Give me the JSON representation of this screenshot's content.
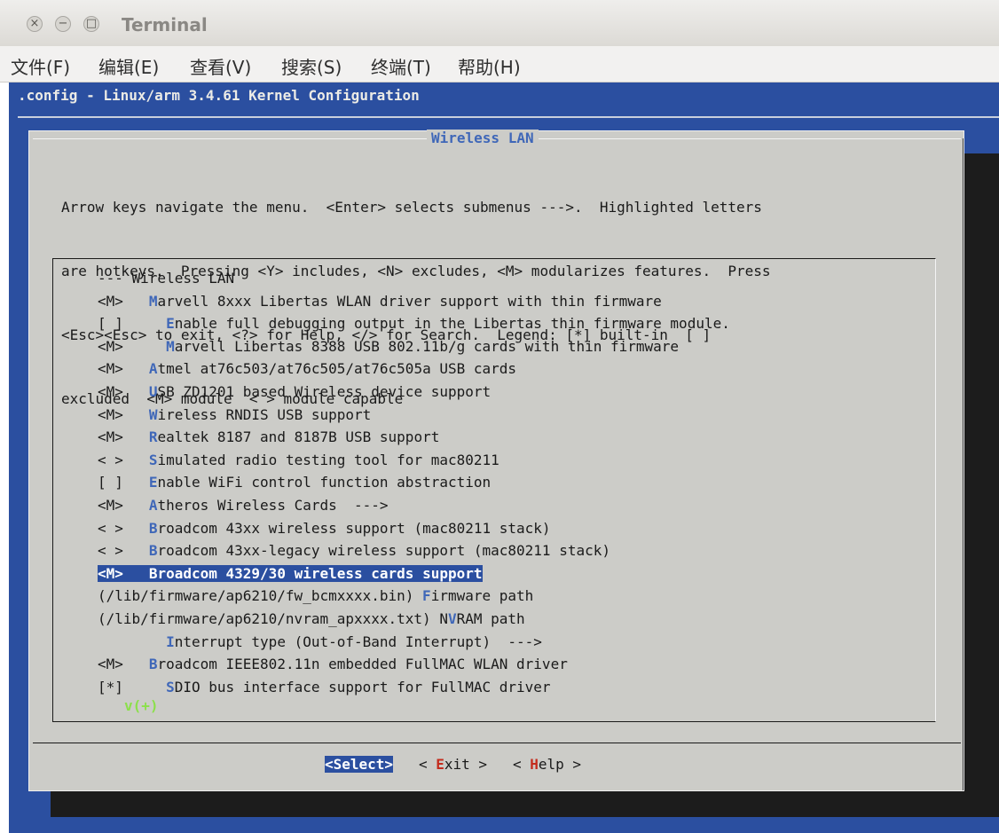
{
  "window": {
    "title": "Terminal",
    "close_glyph": "×",
    "min_glyph": "−",
    "max_glyph": "□"
  },
  "menubar": {
    "items": [
      "文件(F)",
      "编辑(E)",
      "查看(V)",
      "搜索(S)",
      "终端(T)",
      "帮助(H)"
    ]
  },
  "terminal": {
    "config_title": ".config - Linux/arm 3.4.61 Kernel Configuration",
    "dialog": {
      "title": "Wireless LAN",
      "help_lines": [
        "Arrow keys navigate the menu.  <Enter> selects submenus --->.  Highlighted letters",
        "are hotkeys.  Pressing <Y> includes, <N> excludes, <M> modularizes features.  Press",
        "<Esc><Esc> to exit, <?> for Help, </> for Search.  Legend: [*] built-in  [ ]",
        "excluded  <M> module  < > module capable"
      ],
      "items": [
        {
          "prefix": "",
          "indent": "",
          "hotkey": "",
          "rest": "--- Wireless LAN",
          "selected": false
        },
        {
          "prefix": "<M>",
          "indent": "",
          "hotkey": "M",
          "rest": "arvell 8xxx Libertas WLAN driver support with thin firmware",
          "selected": false
        },
        {
          "prefix": "[ ]",
          "indent": "  ",
          "hotkey": "E",
          "rest": "nable full debugging output in the Libertas thin firmware module.",
          "selected": false
        },
        {
          "prefix": "<M>",
          "indent": "  ",
          "hotkey": "M",
          "rest": "arvell Libertas 8388 USB 802.11b/g cards with thin firmware",
          "selected": false
        },
        {
          "prefix": "<M>",
          "indent": "",
          "hotkey": "A",
          "rest": "tmel at76c503/at76c505/at76c505a USB cards",
          "selected": false
        },
        {
          "prefix": "<M>",
          "indent": "",
          "hotkey": "U",
          "rest": "SB ZD1201 based Wireless device support",
          "selected": false
        },
        {
          "prefix": "<M>",
          "indent": "",
          "hotkey": "W",
          "rest": "ireless RNDIS USB support",
          "selected": false
        },
        {
          "prefix": "<M>",
          "indent": "",
          "hotkey": "R",
          "rest": "ealtek 8187 and 8187B USB support",
          "selected": false
        },
        {
          "prefix": "< >",
          "indent": "",
          "hotkey": "S",
          "rest": "imulated radio testing tool for mac80211",
          "selected": false
        },
        {
          "prefix": "[ ]",
          "indent": "",
          "hotkey": "E",
          "rest": "nable WiFi control function abstraction",
          "selected": false
        },
        {
          "prefix": "<M>",
          "indent": "",
          "hotkey": "A",
          "rest": "theros Wireless Cards  --->",
          "selected": false
        },
        {
          "prefix": "< >",
          "indent": "",
          "hotkey": "B",
          "rest": "roadcom 43xx wireless support (mac80211 stack)",
          "selected": false
        },
        {
          "prefix": "< >",
          "indent": "",
          "hotkey": "B",
          "rest": "roadcom 43xx-legacy wireless support (mac80211 stack)",
          "selected": false
        },
        {
          "prefix": "<M>",
          "indent": "",
          "hotkey": "B",
          "rest": "roadcom 4329/30 wireless cards support",
          "selected": true
        },
        {
          "prefix": "",
          "indent": "",
          "hotkey": "",
          "rest": "(/lib/firmware/ap6210/fw_bcmxxxx.bin) ",
          "hotkey2": "F",
          "rest2": "irmware path",
          "selected": false
        },
        {
          "prefix": "",
          "indent": "",
          "hotkey": "",
          "rest": "(/lib/firmware/ap6210/nvram_apxxxx.txt) N",
          "hotkey2": "V",
          "rest2": "RAM path",
          "selected": false
        },
        {
          "prefix": "   ",
          "indent": "  ",
          "hotkey": "I",
          "rest": "nterrupt type (Out-of-Band Interrupt)  --->",
          "selected": false
        },
        {
          "prefix": "<M>",
          "indent": "",
          "hotkey": "B",
          "rest": "roadcom IEEE802.11n embedded FullMAC WLAN driver",
          "selected": false
        },
        {
          "prefix": "[*]",
          "indent": "  ",
          "hotkey": "S",
          "rest": "DIO bus interface support for FullMAC driver",
          "selected": false
        }
      ],
      "more_indicator": "v(+)",
      "buttons": {
        "select": "<Select>",
        "exit_pre": "< ",
        "exit_hot": "E",
        "exit_rest": "xit >",
        "help_pre": "< ",
        "help_hot": "H",
        "help_rest": "elp >"
      }
    }
  },
  "colors": {
    "terminal_bg": "#2b4fa0",
    "dialog_bg": "#ccccc8",
    "hotkey": "#3f67b8",
    "more_indicator": "#8be04a",
    "button_hotkey": "#c42b1c"
  }
}
